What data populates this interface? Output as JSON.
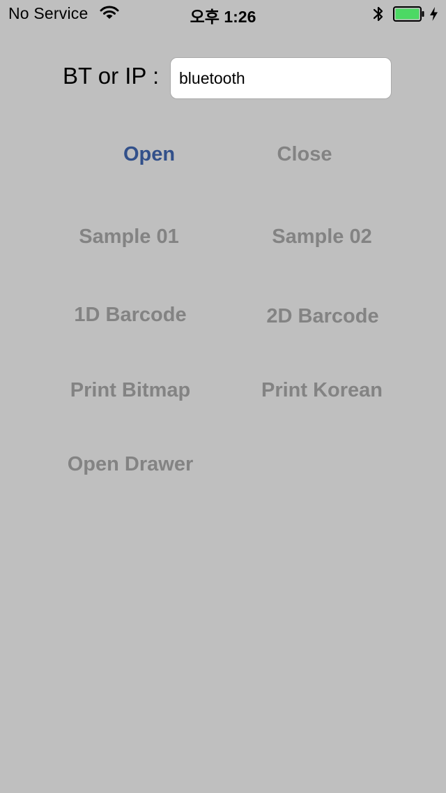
{
  "status_bar": {
    "carrier": "No Service",
    "time": "오후 1:26",
    "battery_color": "#4cd964",
    "icons": [
      "wifi-icon",
      "bluetooth-icon",
      "battery-icon",
      "charging-icon"
    ]
  },
  "connection": {
    "label": "BT or IP :",
    "value": "bluetooth"
  },
  "buttons": {
    "open": "Open",
    "close": "Close",
    "sample_01": "Sample 01",
    "sample_02": "Sample 02",
    "barcode_1d": "1D Barcode",
    "barcode_2d": "2D Barcode",
    "print_bitmap": "Print Bitmap",
    "print_korean": "Print Korean",
    "open_drawer": "Open Drawer"
  },
  "colors": {
    "background": "#bfbfbf",
    "enabled_button": "#32508a",
    "disabled_button": "#838383"
  }
}
